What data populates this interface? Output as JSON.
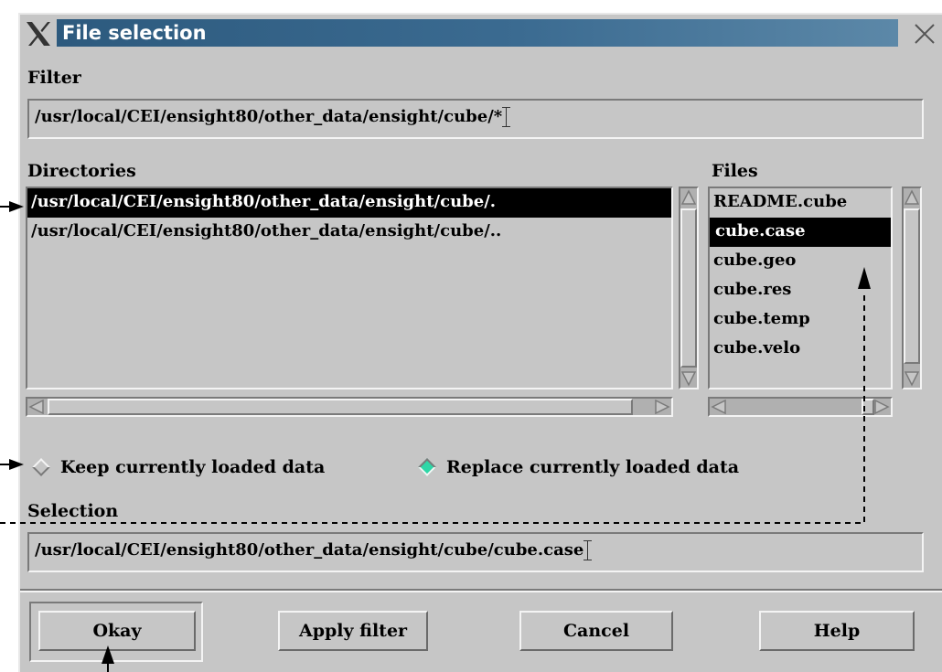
{
  "window": {
    "title": "File selection"
  },
  "filter": {
    "label": "Filter",
    "value": "/usr/local/CEI/ensight80/other_data/ensight/cube/*"
  },
  "directories": {
    "label": "Directories",
    "items": [
      "/usr/local/CEI/ensight80/other_data/ensight/cube/.",
      "/usr/local/CEI/ensight80/other_data/ensight/cube/.."
    ],
    "selected_index": 0
  },
  "files": {
    "label": "Files",
    "items": [
      "README.cube",
      "cube.case",
      "cube.geo",
      "cube.res",
      "cube.temp",
      "cube.velo"
    ],
    "selected_index": 1
  },
  "options": {
    "keep_label": "Keep currently loaded data",
    "replace_label": "Replace currently loaded data",
    "selected": "replace"
  },
  "selection": {
    "label": "Selection",
    "value": "/usr/local/CEI/ensight80/other_data/ensight/cube/cube.case"
  },
  "buttons": {
    "okay": "Okay",
    "apply": "Apply filter",
    "cancel": "Cancel",
    "help": "Help"
  },
  "colors": {
    "title_bar": "#3b6b91",
    "radio_on": "#2ed7a7",
    "panel": "#c6c6c6"
  },
  "icons": [
    "x-window-logo-icon",
    "close-icon",
    "scroll-arrow-icon",
    "i-beam-cursor-icon"
  ]
}
